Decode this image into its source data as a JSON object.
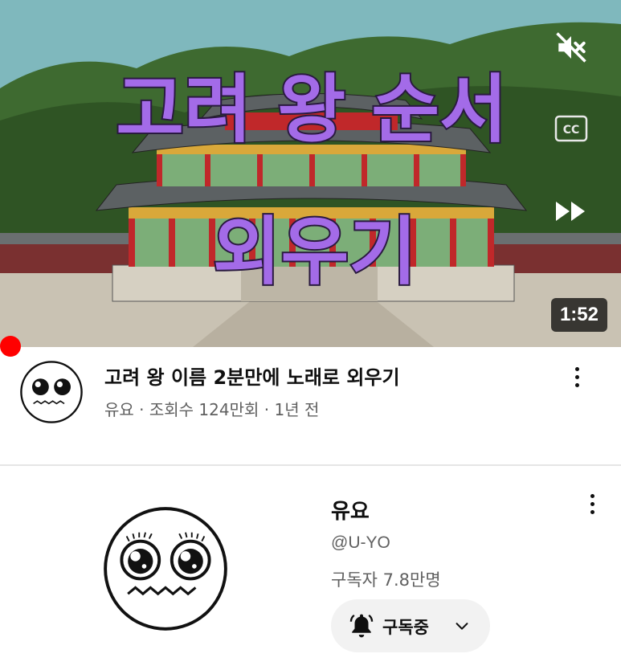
{
  "thumbnail": {
    "overlay_title_line1": "고려 왕 순서",
    "overlay_title_line2": "외우기",
    "duration": "1:52",
    "controls": [
      "mute-icon",
      "captions-icon",
      "skip-forward-icon"
    ],
    "colors": {
      "sky": "#7fb8bd",
      "title_purple": "#a36be8",
      "title_yellow": "#f4e04a",
      "progress": "#ff0000"
    }
  },
  "video": {
    "title": "고려 왕 이름 2분만에 노래로 외우기",
    "meta": "유요 · 조회수 124만회 · 1년 전"
  },
  "channel": {
    "name": "유요",
    "handle": "@U-YO",
    "subscribers": "구독자 7.8만명",
    "subscribe_label": "구독중"
  }
}
